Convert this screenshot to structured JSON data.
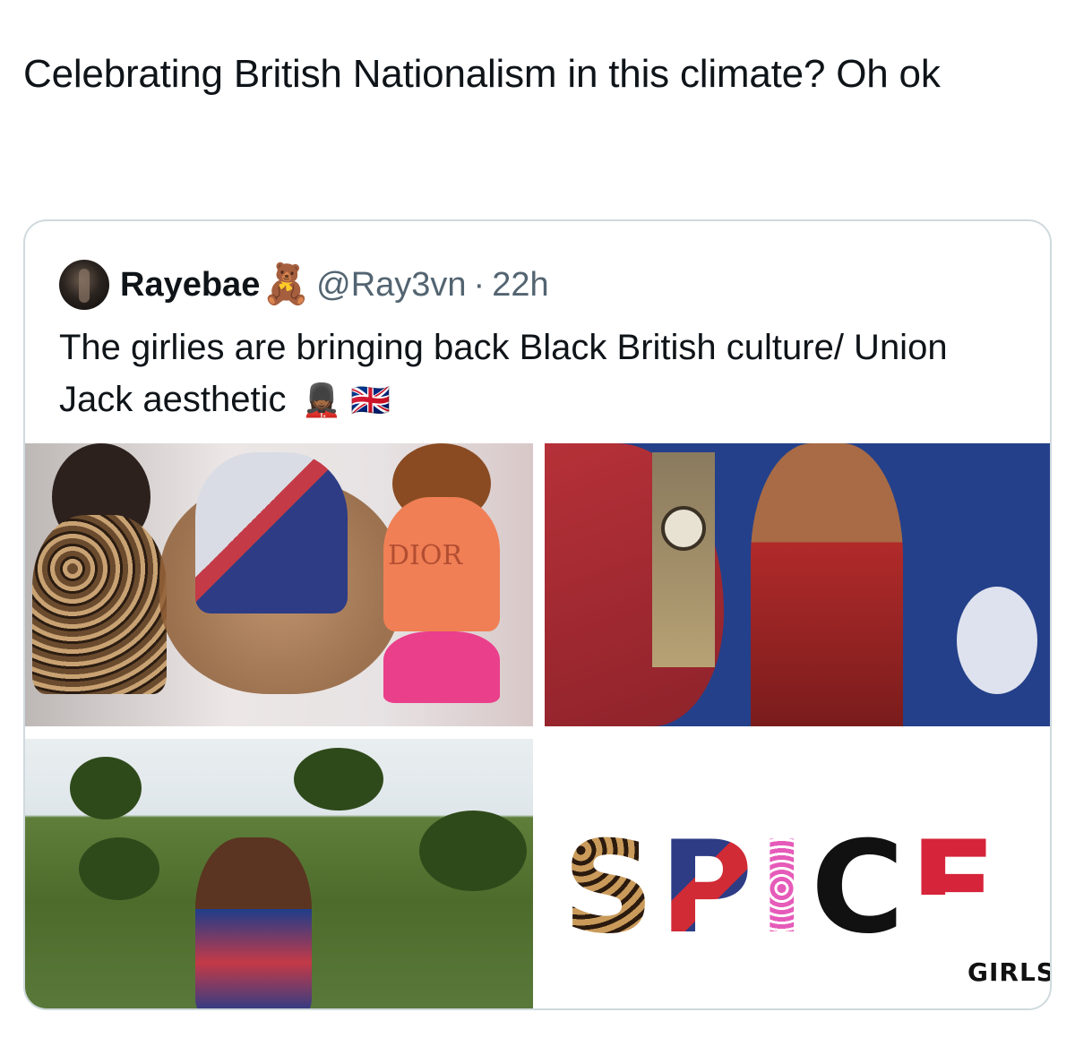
{
  "tweet": {
    "text": "Celebrating British Nationalism in this climate? Oh ok"
  },
  "quoted_tweet": {
    "display_name": "Rayebae",
    "name_emoji": "🧸",
    "handle": "@Ray3vn",
    "separator": "·",
    "time": "22h",
    "body": "The girlies are bringing back Black British culture/ Union Jack aesthetic",
    "body_emojis": "💂🏾‍♀️ 🇬🇧",
    "avatar_icon": "avatar"
  },
  "media": {
    "tile1_shirt_text": "DIOR",
    "tile4_word": [
      "S",
      "P",
      "I",
      "C",
      "E"
    ],
    "tile4_subtext": "GIRLS"
  },
  "colors": {
    "text": "#0f1419",
    "secondary": "#536471",
    "border": "#cfd9de"
  }
}
